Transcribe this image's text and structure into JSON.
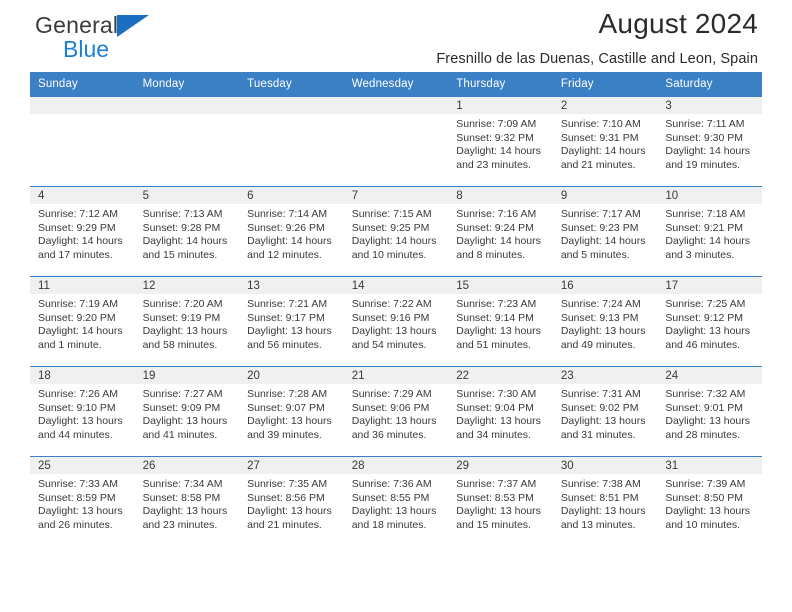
{
  "brand": {
    "name_top": "General",
    "name_bottom": "Blue"
  },
  "header": {
    "title": "August 2024",
    "subtitle": "Fresnillo de las Duenas, Castille and Leon, Spain"
  },
  "calendar": {
    "weekday_headers": [
      "Sunday",
      "Monday",
      "Tuesday",
      "Wednesday",
      "Thursday",
      "Friday",
      "Saturday"
    ],
    "colors": {
      "header_bg": "#3b7fc4",
      "header_text": "#ffffff",
      "daynum_bg": "#f0f0f0",
      "cell_bg": "#ffffff",
      "grid_line": "#3b7fc4",
      "brand_blue": "#1b7fd4"
    },
    "weeks": [
      [
        {
          "day": "",
          "sunrise": "",
          "sunset": "",
          "daylight_line1": "",
          "daylight_line2": ""
        },
        {
          "day": "",
          "sunrise": "",
          "sunset": "",
          "daylight_line1": "",
          "daylight_line2": ""
        },
        {
          "day": "",
          "sunrise": "",
          "sunset": "",
          "daylight_line1": "",
          "daylight_line2": ""
        },
        {
          "day": "",
          "sunrise": "",
          "sunset": "",
          "daylight_line1": "",
          "daylight_line2": ""
        },
        {
          "day": "1",
          "sunrise": "Sunrise: 7:09 AM",
          "sunset": "Sunset: 9:32 PM",
          "daylight_line1": "Daylight: 14 hours",
          "daylight_line2": "and 23 minutes."
        },
        {
          "day": "2",
          "sunrise": "Sunrise: 7:10 AM",
          "sunset": "Sunset: 9:31 PM",
          "daylight_line1": "Daylight: 14 hours",
          "daylight_line2": "and 21 minutes."
        },
        {
          "day": "3",
          "sunrise": "Sunrise: 7:11 AM",
          "sunset": "Sunset: 9:30 PM",
          "daylight_line1": "Daylight: 14 hours",
          "daylight_line2": "and 19 minutes."
        }
      ],
      [
        {
          "day": "4",
          "sunrise": "Sunrise: 7:12 AM",
          "sunset": "Sunset: 9:29 PM",
          "daylight_line1": "Daylight: 14 hours",
          "daylight_line2": "and 17 minutes."
        },
        {
          "day": "5",
          "sunrise": "Sunrise: 7:13 AM",
          "sunset": "Sunset: 9:28 PM",
          "daylight_line1": "Daylight: 14 hours",
          "daylight_line2": "and 15 minutes."
        },
        {
          "day": "6",
          "sunrise": "Sunrise: 7:14 AM",
          "sunset": "Sunset: 9:26 PM",
          "daylight_line1": "Daylight: 14 hours",
          "daylight_line2": "and 12 minutes."
        },
        {
          "day": "7",
          "sunrise": "Sunrise: 7:15 AM",
          "sunset": "Sunset: 9:25 PM",
          "daylight_line1": "Daylight: 14 hours",
          "daylight_line2": "and 10 minutes."
        },
        {
          "day": "8",
          "sunrise": "Sunrise: 7:16 AM",
          "sunset": "Sunset: 9:24 PM",
          "daylight_line1": "Daylight: 14 hours",
          "daylight_line2": "and 8 minutes."
        },
        {
          "day": "9",
          "sunrise": "Sunrise: 7:17 AM",
          "sunset": "Sunset: 9:23 PM",
          "daylight_line1": "Daylight: 14 hours",
          "daylight_line2": "and 5 minutes."
        },
        {
          "day": "10",
          "sunrise": "Sunrise: 7:18 AM",
          "sunset": "Sunset: 9:21 PM",
          "daylight_line1": "Daylight: 14 hours",
          "daylight_line2": "and 3 minutes."
        }
      ],
      [
        {
          "day": "11",
          "sunrise": "Sunrise: 7:19 AM",
          "sunset": "Sunset: 9:20 PM",
          "daylight_line1": "Daylight: 14 hours",
          "daylight_line2": "and 1 minute."
        },
        {
          "day": "12",
          "sunrise": "Sunrise: 7:20 AM",
          "sunset": "Sunset: 9:19 PM",
          "daylight_line1": "Daylight: 13 hours",
          "daylight_line2": "and 58 minutes."
        },
        {
          "day": "13",
          "sunrise": "Sunrise: 7:21 AM",
          "sunset": "Sunset: 9:17 PM",
          "daylight_line1": "Daylight: 13 hours",
          "daylight_line2": "and 56 minutes."
        },
        {
          "day": "14",
          "sunrise": "Sunrise: 7:22 AM",
          "sunset": "Sunset: 9:16 PM",
          "daylight_line1": "Daylight: 13 hours",
          "daylight_line2": "and 54 minutes."
        },
        {
          "day": "15",
          "sunrise": "Sunrise: 7:23 AM",
          "sunset": "Sunset: 9:14 PM",
          "daylight_line1": "Daylight: 13 hours",
          "daylight_line2": "and 51 minutes."
        },
        {
          "day": "16",
          "sunrise": "Sunrise: 7:24 AM",
          "sunset": "Sunset: 9:13 PM",
          "daylight_line1": "Daylight: 13 hours",
          "daylight_line2": "and 49 minutes."
        },
        {
          "day": "17",
          "sunrise": "Sunrise: 7:25 AM",
          "sunset": "Sunset: 9:12 PM",
          "daylight_line1": "Daylight: 13 hours",
          "daylight_line2": "and 46 minutes."
        }
      ],
      [
        {
          "day": "18",
          "sunrise": "Sunrise: 7:26 AM",
          "sunset": "Sunset: 9:10 PM",
          "daylight_line1": "Daylight: 13 hours",
          "daylight_line2": "and 44 minutes."
        },
        {
          "day": "19",
          "sunrise": "Sunrise: 7:27 AM",
          "sunset": "Sunset: 9:09 PM",
          "daylight_line1": "Daylight: 13 hours",
          "daylight_line2": "and 41 minutes."
        },
        {
          "day": "20",
          "sunrise": "Sunrise: 7:28 AM",
          "sunset": "Sunset: 9:07 PM",
          "daylight_line1": "Daylight: 13 hours",
          "daylight_line2": "and 39 minutes."
        },
        {
          "day": "21",
          "sunrise": "Sunrise: 7:29 AM",
          "sunset": "Sunset: 9:06 PM",
          "daylight_line1": "Daylight: 13 hours",
          "daylight_line2": "and 36 minutes."
        },
        {
          "day": "22",
          "sunrise": "Sunrise: 7:30 AM",
          "sunset": "Sunset: 9:04 PM",
          "daylight_line1": "Daylight: 13 hours",
          "daylight_line2": "and 34 minutes."
        },
        {
          "day": "23",
          "sunrise": "Sunrise: 7:31 AM",
          "sunset": "Sunset: 9:02 PM",
          "daylight_line1": "Daylight: 13 hours",
          "daylight_line2": "and 31 minutes."
        },
        {
          "day": "24",
          "sunrise": "Sunrise: 7:32 AM",
          "sunset": "Sunset: 9:01 PM",
          "daylight_line1": "Daylight: 13 hours",
          "daylight_line2": "and 28 minutes."
        }
      ],
      [
        {
          "day": "25",
          "sunrise": "Sunrise: 7:33 AM",
          "sunset": "Sunset: 8:59 PM",
          "daylight_line1": "Daylight: 13 hours",
          "daylight_line2": "and 26 minutes."
        },
        {
          "day": "26",
          "sunrise": "Sunrise: 7:34 AM",
          "sunset": "Sunset: 8:58 PM",
          "daylight_line1": "Daylight: 13 hours",
          "daylight_line2": "and 23 minutes."
        },
        {
          "day": "27",
          "sunrise": "Sunrise: 7:35 AM",
          "sunset": "Sunset: 8:56 PM",
          "daylight_line1": "Daylight: 13 hours",
          "daylight_line2": "and 21 minutes."
        },
        {
          "day": "28",
          "sunrise": "Sunrise: 7:36 AM",
          "sunset": "Sunset: 8:55 PM",
          "daylight_line1": "Daylight: 13 hours",
          "daylight_line2": "and 18 minutes."
        },
        {
          "day": "29",
          "sunrise": "Sunrise: 7:37 AM",
          "sunset": "Sunset: 8:53 PM",
          "daylight_line1": "Daylight: 13 hours",
          "daylight_line2": "and 15 minutes."
        },
        {
          "day": "30",
          "sunrise": "Sunrise: 7:38 AM",
          "sunset": "Sunset: 8:51 PM",
          "daylight_line1": "Daylight: 13 hours",
          "daylight_line2": "and 13 minutes."
        },
        {
          "day": "31",
          "sunrise": "Sunrise: 7:39 AM",
          "sunset": "Sunset: 8:50 PM",
          "daylight_line1": "Daylight: 13 hours",
          "daylight_line2": "and 10 minutes."
        }
      ]
    ]
  }
}
